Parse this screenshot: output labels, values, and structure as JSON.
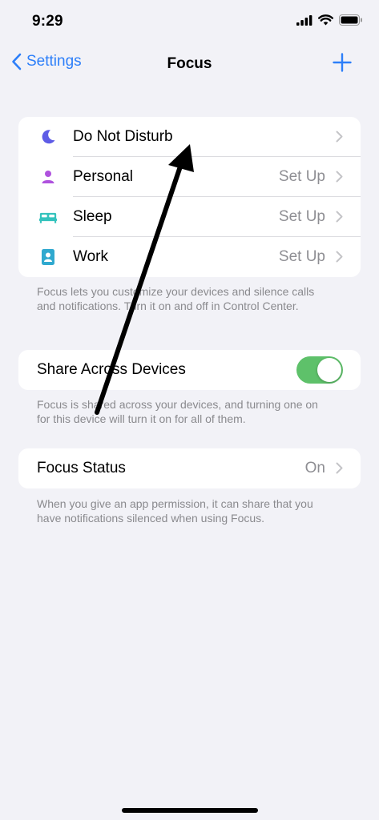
{
  "status_bar": {
    "time": "9:29"
  },
  "nav": {
    "back_label": "Settings",
    "title": "Focus"
  },
  "focus_modes": [
    {
      "label": "Do Not Disturb",
      "value": "",
      "icon": "moon-icon",
      "color": "#5e5ce6"
    },
    {
      "label": "Personal",
      "value": "Set Up",
      "icon": "person-icon",
      "color": "#af52de"
    },
    {
      "label": "Sleep",
      "value": "Set Up",
      "icon": "bed-icon",
      "color": "#34c3bd"
    },
    {
      "label": "Work",
      "value": "Set Up",
      "icon": "id-badge-icon",
      "color": "#30a9cf"
    }
  ],
  "focus_footnote": "Focus lets you customize your devices and silence calls and notifications. Turn it on and off in Control Center.",
  "share": {
    "label": "Share Across Devices",
    "enabled": true,
    "footnote": "Focus is shared across your devices, and turning one on for this device will turn it on for all of them."
  },
  "focus_status": {
    "label": "Focus Status",
    "value": "On",
    "footnote": "When you give an app permission, it can share that you have notifications silenced when using Focus."
  },
  "colors": {
    "accent": "#2d7ff9",
    "toggle_on": "#5ec16a",
    "background": "#f2f2f7"
  }
}
